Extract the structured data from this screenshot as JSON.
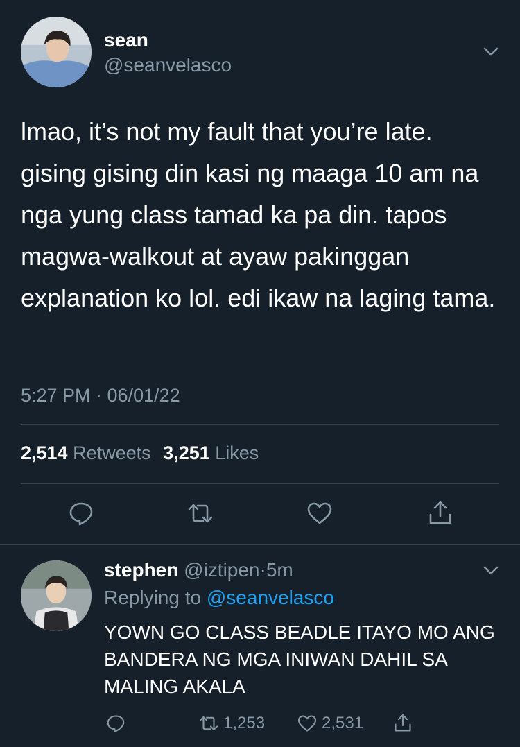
{
  "main_tweet": {
    "display_name": "sean",
    "handle": "@seanvelasco",
    "text": "lmao, it’s not my fault that you’re late. gising gising din kasi ng maaga 10 am na nga yung class tamad ka pa din. tapos magwa-walkout at ayaw pakinggan explanation ko lol. edi ikaw na laging tama.",
    "timestamp": "5:27 PM · 06/01/22",
    "retweets_count": "2,514",
    "retweets_label": "Retweets",
    "likes_count": "3,251",
    "likes_label": "Likes",
    "icons": [
      "chevron-down-icon",
      "reply-icon",
      "retweet-icon",
      "like-icon",
      "share-icon"
    ]
  },
  "reply": {
    "display_name": "stephen",
    "handle": "@iztipen",
    "time_separator": "·",
    "time": "5m",
    "replying_label": "Replying to",
    "replying_to": "@seanvelasco",
    "text": "YOWN GO CLASS BEADLE ITAYO MO ANG BANDERA NG MGA INIWAN DAHIL SA MALING AKALA",
    "retweets_count": "1,253",
    "likes_count": "2,531"
  },
  "colors": {
    "background": "#15202b",
    "secondary_text": "#8899a6",
    "divider": "#38444d",
    "link": "#1da1f2",
    "primary_text": "#ffffff"
  }
}
